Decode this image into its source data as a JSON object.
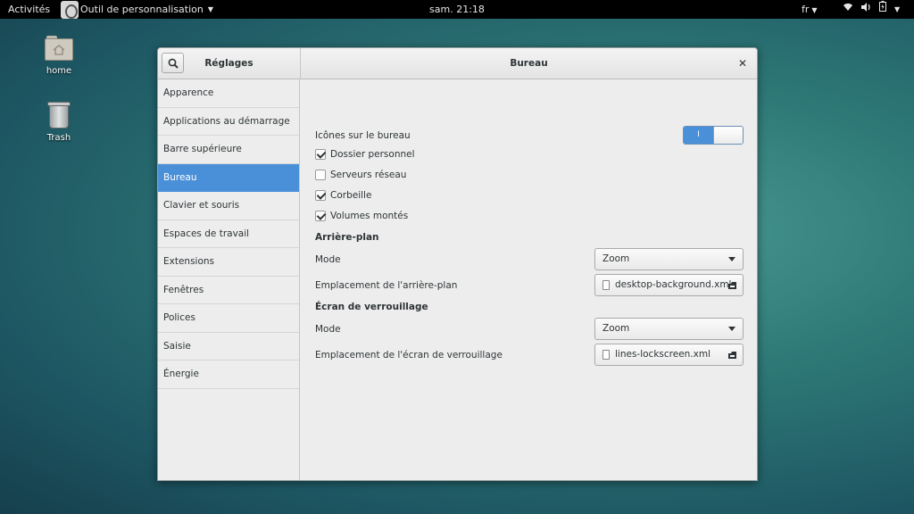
{
  "topbar": {
    "activities": "Activités",
    "app_menu": "Outil de personnalisation",
    "clock": "sam. 21:18",
    "language": "fr",
    "icons": [
      "wifi-icon",
      "volume-icon",
      "battery-icon",
      "power-icon"
    ]
  },
  "desktop": {
    "icons": [
      {
        "label": "home",
        "icon": "folder-home-icon"
      },
      {
        "label": "Trash",
        "icon": "trash-icon"
      }
    ]
  },
  "window": {
    "sidebar_title": "Réglages",
    "content_title": "Bureau",
    "close_icon": "close-icon",
    "search_icon": "search-icon"
  },
  "sidebar": {
    "items": [
      {
        "label": "Apparence"
      },
      {
        "label": "Applications au démarrage"
      },
      {
        "label": "Barre supérieure"
      },
      {
        "label": "Bureau",
        "active": true
      },
      {
        "label": "Clavier et souris"
      },
      {
        "label": "Espaces de travail"
      },
      {
        "label": "Extensions"
      },
      {
        "label": "Fenêtres"
      },
      {
        "label": "Polices"
      },
      {
        "label": "Saisie"
      },
      {
        "label": "Énergie"
      }
    ]
  },
  "content": {
    "desktop_icons_label": "Icônes sur le bureau",
    "desktop_icons_switch": {
      "state": "on",
      "on_mark": "I"
    },
    "checks": [
      {
        "label": "Dossier personnel",
        "checked": true
      },
      {
        "label": "Serveurs réseau",
        "checked": false
      },
      {
        "label": "Corbeille",
        "checked": true
      },
      {
        "label": "Volumes montés",
        "checked": true
      }
    ],
    "background": {
      "heading": "Arrière-plan",
      "mode_label": "Mode",
      "mode_value": "Zoom",
      "location_label": "Emplacement de l'arrière-plan",
      "location_value": "desktop-background.xml"
    },
    "lockscreen": {
      "heading": "Écran de verrouillage",
      "mode_label": "Mode",
      "mode_value": "Zoom",
      "location_label": "Emplacement de l'écran de verrouillage",
      "location_value": "lines-lockscreen.xml"
    }
  },
  "colors": {
    "accent": "#4a90d9",
    "topbar": "#000000",
    "window_bg": "#ededed"
  }
}
